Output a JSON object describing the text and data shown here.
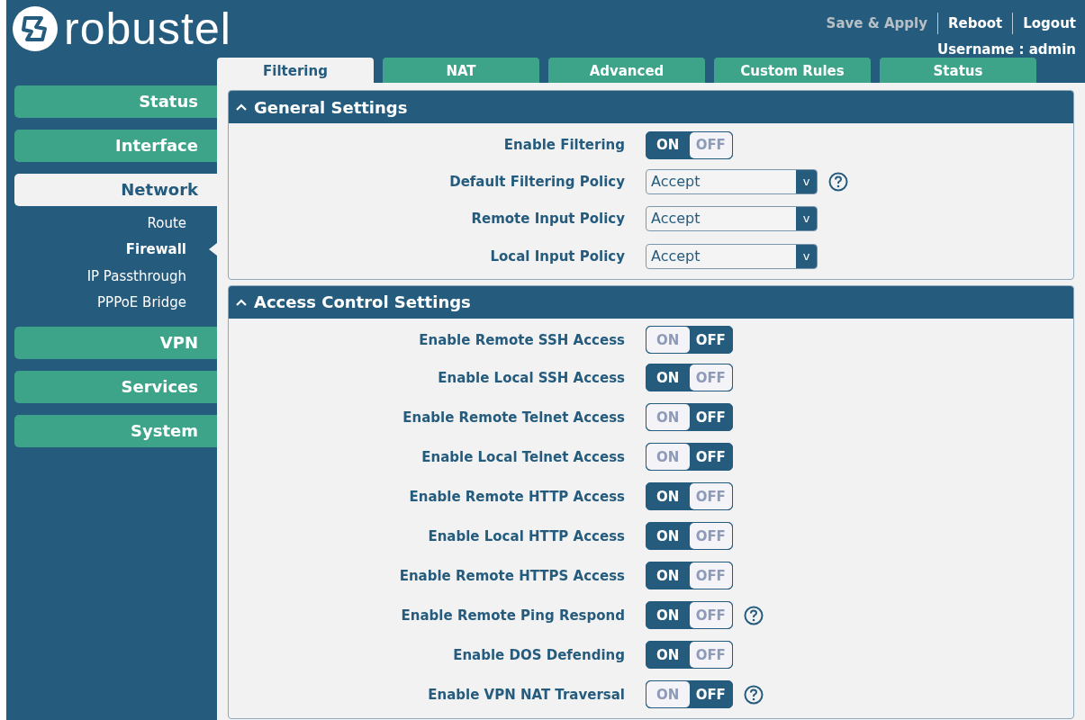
{
  "header": {
    "logo_text": "robustel",
    "actions": [
      "Save & Apply",
      "Reboot",
      "Logout"
    ],
    "user": "Username : admin"
  },
  "tabs": [
    {
      "label": "Filtering",
      "selected": true
    },
    {
      "label": "NAT",
      "selected": false
    },
    {
      "label": "Advanced",
      "selected": false
    },
    {
      "label": "Custom Rules",
      "selected": false
    },
    {
      "label": "Status",
      "selected": false
    }
  ],
  "sidebar": {
    "items": [
      {
        "label": "Status",
        "selected": false
      },
      {
        "label": "Interface",
        "selected": false
      },
      {
        "label": "Network",
        "selected": true,
        "children": [
          {
            "label": "Route",
            "selected": false
          },
          {
            "label": "Firewall",
            "selected": true
          },
          {
            "label": "IP Passthrough",
            "selected": false
          },
          {
            "label": "PPPoE Bridge",
            "selected": false
          }
        ]
      },
      {
        "label": "VPN",
        "selected": false
      },
      {
        "label": "Services",
        "selected": false
      },
      {
        "label": "System",
        "selected": false
      }
    ]
  },
  "sections": [
    {
      "title": "General Settings",
      "expanded": true,
      "rows": [
        {
          "kind": "toggle",
          "label": "Enable Filtering",
          "on": true,
          "on_label": "ON",
          "off_label": "OFF"
        },
        {
          "kind": "select",
          "label": "Default Filtering Policy",
          "value": "Accept",
          "caret": "v",
          "help": true
        },
        {
          "kind": "select",
          "label": "Remote Input Policy",
          "value": "Accept",
          "caret": "v"
        },
        {
          "kind": "select",
          "label": "Local Input Policy",
          "value": "Accept",
          "caret": "v"
        }
      ]
    },
    {
      "title": "Access Control Settings",
      "expanded": true,
      "rows": [
        {
          "kind": "toggle",
          "label": "Enable Remote SSH Access",
          "on": false,
          "on_label": "ON",
          "off_label": "OFF"
        },
        {
          "kind": "toggle",
          "label": "Enable Local SSH Access",
          "on": true,
          "on_label": "ON",
          "off_label": "OFF"
        },
        {
          "kind": "toggle",
          "label": "Enable Remote Telnet Access",
          "on": false,
          "on_label": "ON",
          "off_label": "OFF"
        },
        {
          "kind": "toggle",
          "label": "Enable Local Telnet Access",
          "on": false,
          "on_label": "ON",
          "off_label": "OFF"
        },
        {
          "kind": "toggle",
          "label": "Enable Remote HTTP Access",
          "on": true,
          "on_label": "ON",
          "off_label": "OFF"
        },
        {
          "kind": "toggle",
          "label": "Enable Local HTTP Access",
          "on": true,
          "on_label": "ON",
          "off_label": "OFF"
        },
        {
          "kind": "toggle",
          "label": "Enable Remote HTTPS Access",
          "on": true,
          "on_label": "ON",
          "off_label": "OFF"
        },
        {
          "kind": "toggle",
          "label": "Enable Remote Ping Respond",
          "on": true,
          "on_label": "ON",
          "off_label": "OFF",
          "help": true
        },
        {
          "kind": "toggle",
          "label": "Enable DOS Defending",
          "on": true,
          "on_label": "ON",
          "off_label": "OFF"
        },
        {
          "kind": "toggle",
          "label": "Enable VPN NAT Traversal",
          "on": false,
          "on_label": "ON",
          "off_label": "OFF",
          "help": true
        }
      ]
    }
  ]
}
